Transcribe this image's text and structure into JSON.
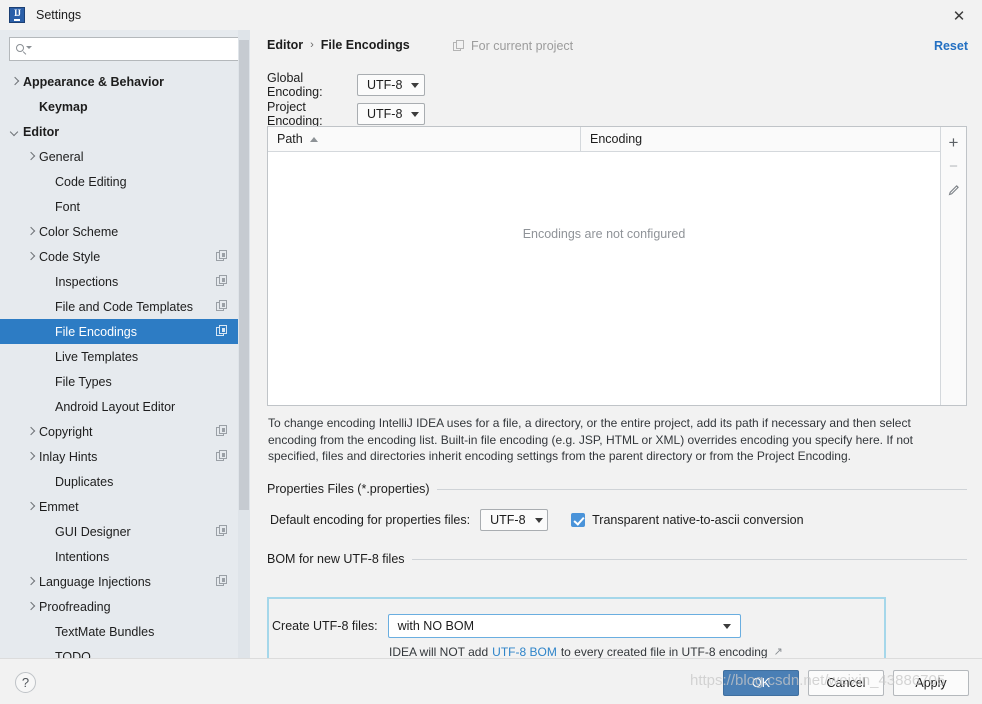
{
  "window": {
    "title": "Settings",
    "logo_text": "IJ",
    "close_label": "✕"
  },
  "sidebar": {
    "search": {
      "value": "",
      "placeholder": ""
    },
    "items": [
      {
        "label": "Appearance & Behavior",
        "indent": 0,
        "arrow": "collapsed",
        "bold": true,
        "scope": false,
        "selected": false
      },
      {
        "label": "Keymap",
        "indent": 1,
        "arrow": "none",
        "bold": true,
        "scope": false,
        "selected": false
      },
      {
        "label": "Editor",
        "indent": 0,
        "arrow": "expanded",
        "bold": true,
        "scope": false,
        "selected": false
      },
      {
        "label": "General",
        "indent": 1,
        "arrow": "collapsed",
        "bold": false,
        "scope": false,
        "selected": false
      },
      {
        "label": "Code Editing",
        "indent": 2,
        "arrow": "none",
        "bold": false,
        "scope": false,
        "selected": false
      },
      {
        "label": "Font",
        "indent": 2,
        "arrow": "none",
        "bold": false,
        "scope": false,
        "selected": false
      },
      {
        "label": "Color Scheme",
        "indent": 1,
        "arrow": "collapsed",
        "bold": false,
        "scope": false,
        "selected": false
      },
      {
        "label": "Code Style",
        "indent": 1,
        "arrow": "collapsed",
        "bold": false,
        "scope": true,
        "selected": false
      },
      {
        "label": "Inspections",
        "indent": 2,
        "arrow": "none",
        "bold": false,
        "scope": true,
        "selected": false
      },
      {
        "label": "File and Code Templates",
        "indent": 2,
        "arrow": "none",
        "bold": false,
        "scope": true,
        "selected": false
      },
      {
        "label": "File Encodings",
        "indent": 2,
        "arrow": "none",
        "bold": false,
        "scope": true,
        "selected": true
      },
      {
        "label": "Live Templates",
        "indent": 2,
        "arrow": "none",
        "bold": false,
        "scope": false,
        "selected": false
      },
      {
        "label": "File Types",
        "indent": 2,
        "arrow": "none",
        "bold": false,
        "scope": false,
        "selected": false
      },
      {
        "label": "Android Layout Editor",
        "indent": 2,
        "arrow": "none",
        "bold": false,
        "scope": false,
        "selected": false
      },
      {
        "label": "Copyright",
        "indent": 1,
        "arrow": "collapsed",
        "bold": false,
        "scope": true,
        "selected": false
      },
      {
        "label": "Inlay Hints",
        "indent": 1,
        "arrow": "collapsed",
        "bold": false,
        "scope": true,
        "selected": false
      },
      {
        "label": "Duplicates",
        "indent": 2,
        "arrow": "none",
        "bold": false,
        "scope": false,
        "selected": false
      },
      {
        "label": "Emmet",
        "indent": 1,
        "arrow": "collapsed",
        "bold": false,
        "scope": false,
        "selected": false
      },
      {
        "label": "GUI Designer",
        "indent": 2,
        "arrow": "none",
        "bold": false,
        "scope": true,
        "selected": false
      },
      {
        "label": "Intentions",
        "indent": 2,
        "arrow": "none",
        "bold": false,
        "scope": false,
        "selected": false
      },
      {
        "label": "Language Injections",
        "indent": 1,
        "arrow": "collapsed",
        "bold": false,
        "scope": true,
        "selected": false
      },
      {
        "label": "Proofreading",
        "indent": 1,
        "arrow": "collapsed",
        "bold": false,
        "scope": false,
        "selected": false
      },
      {
        "label": "TextMate Bundles",
        "indent": 2,
        "arrow": "none",
        "bold": false,
        "scope": false,
        "selected": false
      },
      {
        "label": "TODO",
        "indent": 2,
        "arrow": "none",
        "bold": false,
        "scope": false,
        "selected": false
      }
    ]
  },
  "header": {
    "crumb_parent": "Editor",
    "crumb_sep": "›",
    "crumb_current": "File Encodings",
    "scope_note": "For current project",
    "reset_label": "Reset"
  },
  "encodings": {
    "global_label": "Global Encoding:",
    "global_value": "UTF-8",
    "project_label": "Project Encoding:",
    "project_value": "UTF-8"
  },
  "table": {
    "col_path": "Path",
    "col_encoding": "Encoding",
    "empty_message": "Encodings are not configured",
    "tools": {
      "add": "+",
      "remove": "−",
      "edit": "pencil"
    }
  },
  "help_text": "To change encoding IntelliJ IDEA uses for a file, a directory, or the entire project, add its path if necessary and then select encoding from the encoding list. Built-in file encoding (e.g. JSP, HTML or XML) overrides encoding you specify here. If not specified, files and directories inherit encoding settings from the parent directory or from the Project Encoding.",
  "properties_group": {
    "title": "Properties Files (*.properties)",
    "default_encoding_label": "Default encoding for properties files:",
    "default_encoding_value": "UTF-8",
    "checkbox_label": "Transparent native-to-ascii conversion",
    "checkbox_checked": true
  },
  "bom_group": {
    "title": "BOM for new UTF-8 files",
    "create_label": "Create UTF-8 files:",
    "create_value": "with NO BOM",
    "note_prefix": "IDEA will NOT add",
    "note_link": "UTF-8 BOM",
    "note_suffix": "to every created file in UTF-8 encoding",
    "external_arrow": "↗",
    "highlight_color": "#a5d7ea"
  },
  "footer": {
    "help": "?",
    "ok": "OK",
    "cancel": "Cancel",
    "apply": "Apply"
  },
  "watermark": "https://blog.csdn.net/weixin_43886705",
  "colors": {
    "selection_blue": "#2d7cc4",
    "link_blue": "#2470c2",
    "primary_button": "#4a7fb5",
    "checkbox_blue": "#4a93d9",
    "sidebar_bg": "#e6eaee"
  }
}
